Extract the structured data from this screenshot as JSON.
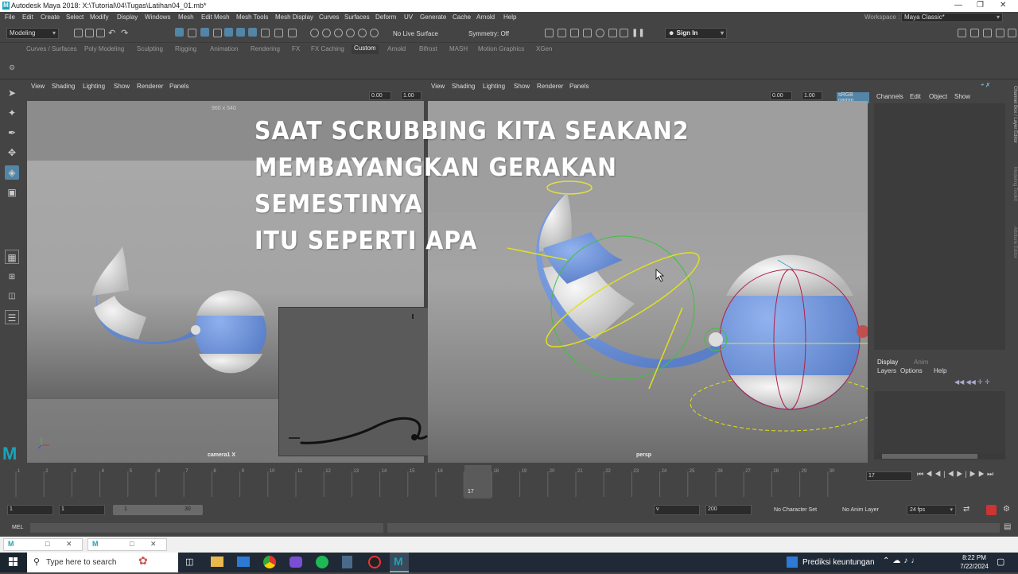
{
  "window": {
    "title": "Autodesk Maya 2018: X:\\Tutorial\\04\\Tugas\\Latihan04_01.mb*",
    "logo": "M"
  },
  "menus": [
    "File",
    "Edit",
    "Create",
    "Select",
    "Modify",
    "Display",
    "Windows",
    "Mesh",
    "Edit Mesh",
    "Mesh Tools",
    "Mesh Display",
    "Curves",
    "Surfaces",
    "Deform",
    "UV",
    "Generate",
    "Cache",
    "Arnold",
    "Help"
  ],
  "workspace": {
    "label": "Workspace :",
    "value": "Maya Classic*"
  },
  "statusline": {
    "menuset": "Modeling",
    "live_surface": "No Live Surface",
    "symmetry": "Symmetry: Off",
    "sign_in": "Sign In"
  },
  "shelf_tabs": [
    "Curves / Surfaces",
    "Poly Modeling",
    "Sculpting",
    "Rigging",
    "Animation",
    "Rendering",
    "FX",
    "FX Caching",
    "Custom",
    "Arnold",
    "Bifrost",
    "MASH",
    "Motion Graphics",
    "XGen"
  ],
  "shelf_selected": "Custom",
  "panel_menus": [
    "View",
    "Shading",
    "Lighting",
    "Show",
    "Renderer",
    "Panels"
  ],
  "left_view": {
    "resolution": "960 x 540",
    "camera": "camera1 X",
    "field_a": "0.00",
    "field_b": "1.00"
  },
  "right_view": {
    "camera": "persp",
    "field_a": "0.00",
    "field_b": "1.00",
    "color_space": "sRGB gamm"
  },
  "channel_box": {
    "menus": [
      "Channels",
      "Edit",
      "Object",
      "Show"
    ],
    "side_tabs": [
      "Channel Box / Layer Editor",
      "Modeling Toolkit",
      "Attribute Editor"
    ]
  },
  "layer_editor": {
    "tabs": [
      "Display",
      "Anim"
    ],
    "menus": [
      "Layers",
      "Options",
      "Help"
    ]
  },
  "overlay_caption": [
    "Saat scrubbing kita seakan2",
    "membayangkan gerakan semestinya",
    "itu seperti apa"
  ],
  "timeline": {
    "ticks": [
      "1",
      "2",
      "3",
      "4",
      "5",
      "6",
      "7",
      "8",
      "9",
      "10",
      "11",
      "12",
      "13",
      "14",
      "15",
      "16",
      "17",
      "18",
      "19",
      "20",
      "21",
      "22",
      "23",
      "24",
      "25",
      "26",
      "27",
      "28",
      "29",
      "30"
    ],
    "current_frame": "17",
    "current_field": "17"
  },
  "range": {
    "start": "1",
    "start_inner": "1",
    "slider_start": "1",
    "slider_end": "30",
    "end_inner": "v",
    "end": "200",
    "character_set": "No Character Set",
    "anim_layer": "No Anim Layer",
    "fps": "24 fps"
  },
  "mel": {
    "label": "MEL"
  },
  "taskbar": {
    "search": "Type here to search",
    "news": "Prediksi keuntungan",
    "time": "8:22 PM",
    "date": "7/22/2024"
  }
}
